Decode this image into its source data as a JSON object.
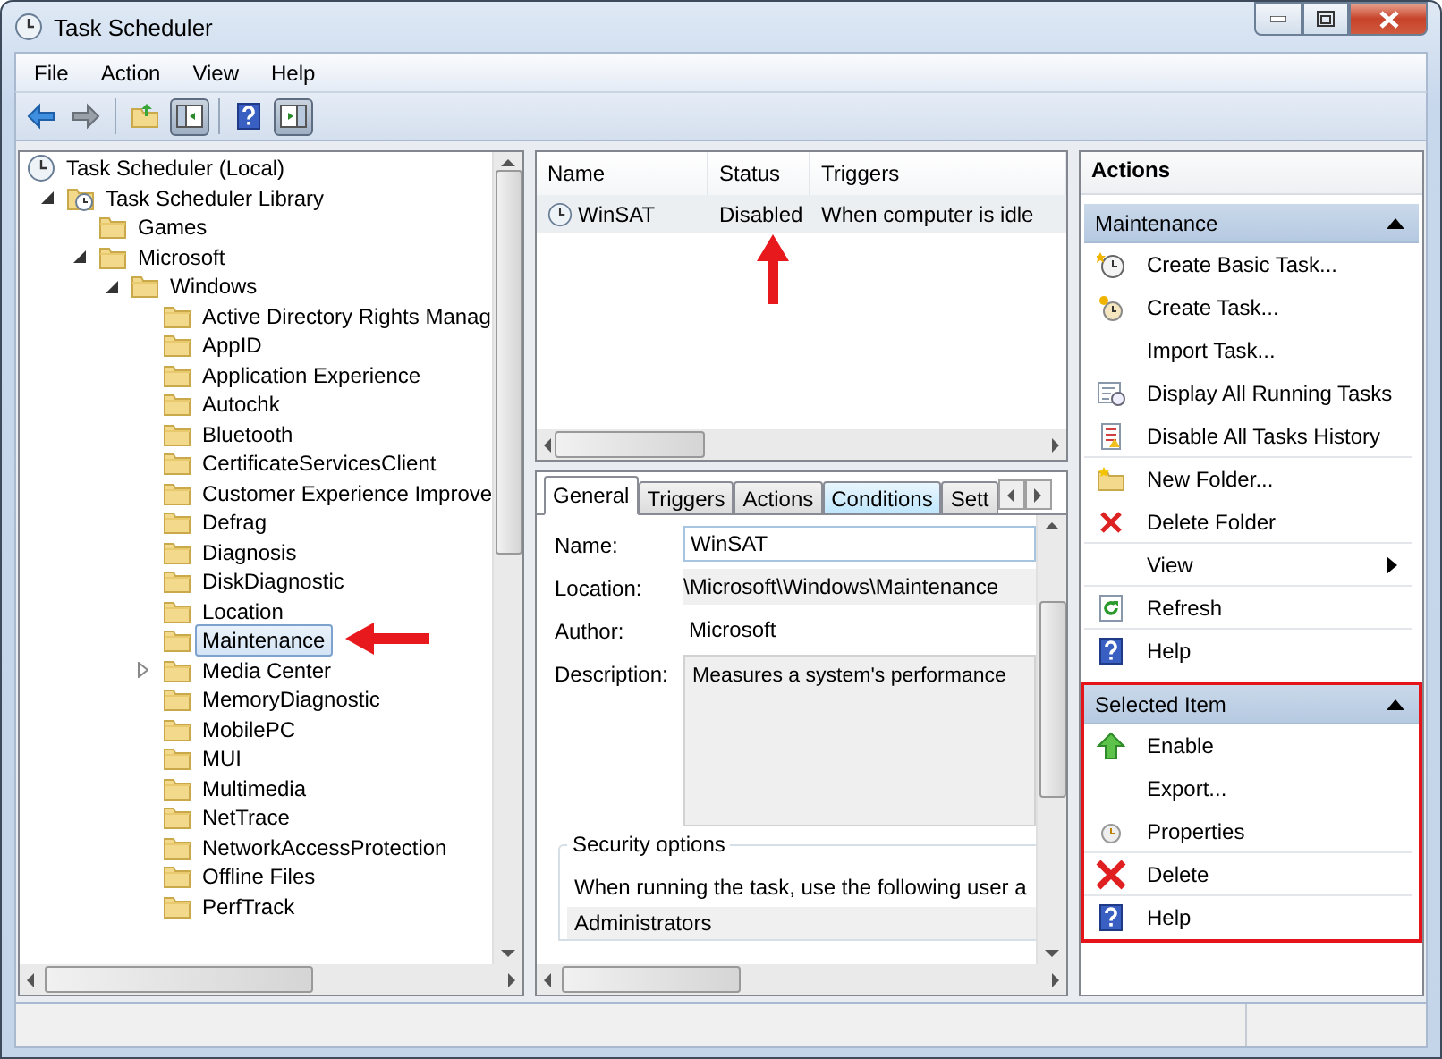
{
  "window": {
    "title": "Task Scheduler"
  },
  "menu": [
    {
      "label": "File"
    },
    {
      "label": "Action"
    },
    {
      "label": "View"
    },
    {
      "label": "Help"
    }
  ],
  "toolbar": [
    {
      "kind": "back",
      "pressed": false
    },
    {
      "kind": "forward",
      "pressed": false
    },
    {
      "kind": "up-folder",
      "pressed": false
    },
    {
      "kind": "console-tree",
      "pressed": true
    },
    {
      "kind": "help",
      "pressed": false
    },
    {
      "kind": "action-pane",
      "pressed": true
    }
  ],
  "tree": [
    {
      "label": "Task Scheduler (Local)",
      "selected": false,
      "children": [
        {
          "label": "Task Scheduler Library",
          "selected": false,
          "expanded": true,
          "children": [
            {
              "label": "Games",
              "selected": false
            },
            {
              "label": "Microsoft",
              "selected": false,
              "expanded": true,
              "children": [
                {
                  "label": "Windows",
                  "selected": false,
                  "expanded": true,
                  "children": [
                    {
                      "label": "Active Directory Rights Manag",
                      "selected": false
                    },
                    {
                      "label": "AppID",
                      "selected": false
                    },
                    {
                      "label": "Application Experience",
                      "selected": false
                    },
                    {
                      "label": "Autochk",
                      "selected": false
                    },
                    {
                      "label": "Bluetooth",
                      "selected": false
                    },
                    {
                      "label": "CertificateServicesClient",
                      "selected": false
                    },
                    {
                      "label": "Customer Experience Improve",
                      "selected": false
                    },
                    {
                      "label": "Defrag",
                      "selected": false
                    },
                    {
                      "label": "Diagnosis",
                      "selected": false
                    },
                    {
                      "label": "DiskDiagnostic",
                      "selected": false
                    },
                    {
                      "label": "Location",
                      "selected": false
                    },
                    {
                      "label": "Maintenance",
                      "selected": true
                    },
                    {
                      "label": "Media Center",
                      "selected": false,
                      "expanded": false
                    },
                    {
                      "label": "MemoryDiagnostic",
                      "selected": false
                    },
                    {
                      "label": "MobilePC",
                      "selected": false
                    },
                    {
                      "label": "MUI",
                      "selected": false
                    },
                    {
                      "label": "Multimedia",
                      "selected": false
                    },
                    {
                      "label": "NetTrace",
                      "selected": false
                    },
                    {
                      "label": "NetworkAccessProtection",
                      "selected": false
                    },
                    {
                      "label": "Offline Files",
                      "selected": false
                    },
                    {
                      "label": "PerfTrack",
                      "selected": false
                    }
                  ]
                }
              ]
            }
          ]
        }
      ]
    }
  ],
  "task_list": {
    "columns": [
      "Name",
      "Status",
      "Triggers"
    ],
    "rows": [
      {
        "cells": [
          "WinSAT",
          "Disabled",
          "When computer is idle"
        ],
        "selected": true
      }
    ]
  },
  "details": {
    "tabs": [
      {
        "label": "General",
        "selected": true,
        "hovered": false
      },
      {
        "label": "Triggers",
        "selected": false,
        "hovered": false
      },
      {
        "label": "Actions",
        "selected": false,
        "hovered": false
      },
      {
        "label": "Conditions",
        "selected": false,
        "hovered": true
      },
      {
        "label": "Sett",
        "selected": false,
        "hovered": false
      }
    ],
    "fields": [
      {
        "kind": "input",
        "label": "Name:",
        "value": "WinSAT"
      },
      {
        "kind": "readonly",
        "label": "Location:",
        "value": "\\Microsoft\\Windows\\Maintenance"
      },
      {
        "kind": "text",
        "label": "Author:",
        "value": "Microsoft"
      },
      {
        "kind": "textarea",
        "label": "Description:",
        "value": "Measures a system's performance"
      }
    ],
    "security": {
      "title": "Security options",
      "prompt": "When running the task, use the following user a",
      "account": "Administrators"
    }
  },
  "actions": {
    "title": "Actions",
    "sections": [
      {
        "title": "Maintenance",
        "collapsed": false,
        "highlighted": false,
        "items": [
          {
            "label": "Create Basic Task...",
            "kind": "create-basic",
            "divider": false
          },
          {
            "label": "Create Task...",
            "kind": "create",
            "divider": false
          },
          {
            "label": "Import Task...",
            "kind": "plain",
            "divider": false
          },
          {
            "label": "Display All Running Tasks",
            "kind": "running",
            "divider": false
          },
          {
            "label": "Disable All Tasks History",
            "kind": "history",
            "divider": true
          },
          {
            "label": "New Folder...",
            "kind": "new-folder",
            "divider": false
          },
          {
            "label": "Delete Folder",
            "kind": "delete-small",
            "divider": true
          },
          {
            "label": "View",
            "kind": "submenu",
            "divider": true
          },
          {
            "label": "Refresh",
            "kind": "refresh",
            "divider": true
          },
          {
            "label": "Help",
            "kind": "help",
            "divider": false
          }
        ]
      },
      {
        "title": "Selected Item",
        "collapsed": false,
        "highlighted": true,
        "items": [
          {
            "label": "Enable",
            "kind": "enable",
            "divider": false
          },
          {
            "label": "Export...",
            "kind": "plain",
            "divider": false
          },
          {
            "label": "Properties",
            "kind": "properties",
            "divider": true
          },
          {
            "label": "Delete",
            "kind": "delete",
            "divider": true
          },
          {
            "label": "Help",
            "kind": "help",
            "divider": false
          }
        ]
      }
    ]
  }
}
